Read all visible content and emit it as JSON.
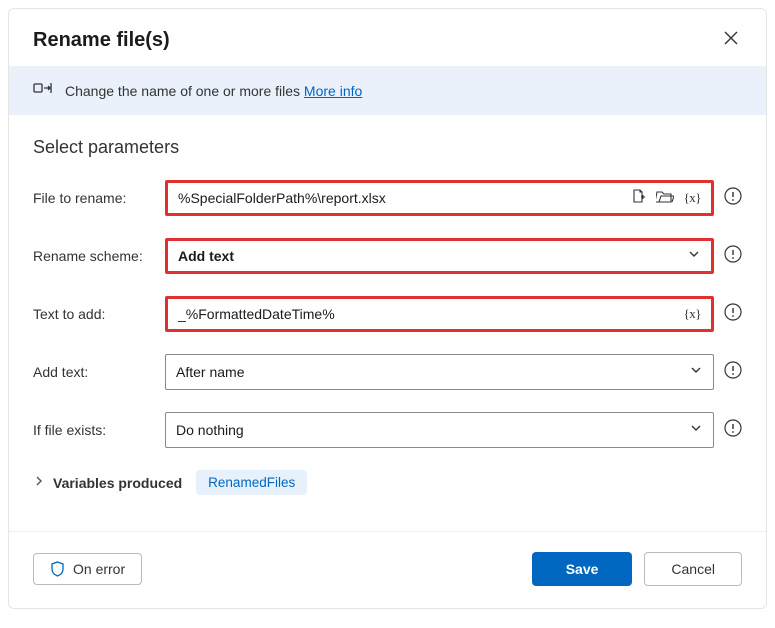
{
  "dialog": {
    "title": "Rename file(s)",
    "banner": {
      "text": "Change the name of one or more files",
      "link": "More info"
    }
  },
  "section_title": "Select parameters",
  "params": {
    "file_to_rename": {
      "label": "File to rename:",
      "value": "%SpecialFolderPath%\\report.xlsx"
    },
    "rename_scheme": {
      "label": "Rename scheme:",
      "value": "Add text"
    },
    "text_to_add": {
      "label": "Text to add:",
      "value": "_%FormattedDateTime%"
    },
    "add_text": {
      "label": "Add text:",
      "value": "After name"
    },
    "if_file_exists": {
      "label": "If file exists:",
      "value": "Do nothing"
    }
  },
  "variables_produced": {
    "label": "Variables produced",
    "items": [
      "RenamedFiles"
    ]
  },
  "footer": {
    "on_error": "On error",
    "save": "Save",
    "cancel": "Cancel"
  }
}
